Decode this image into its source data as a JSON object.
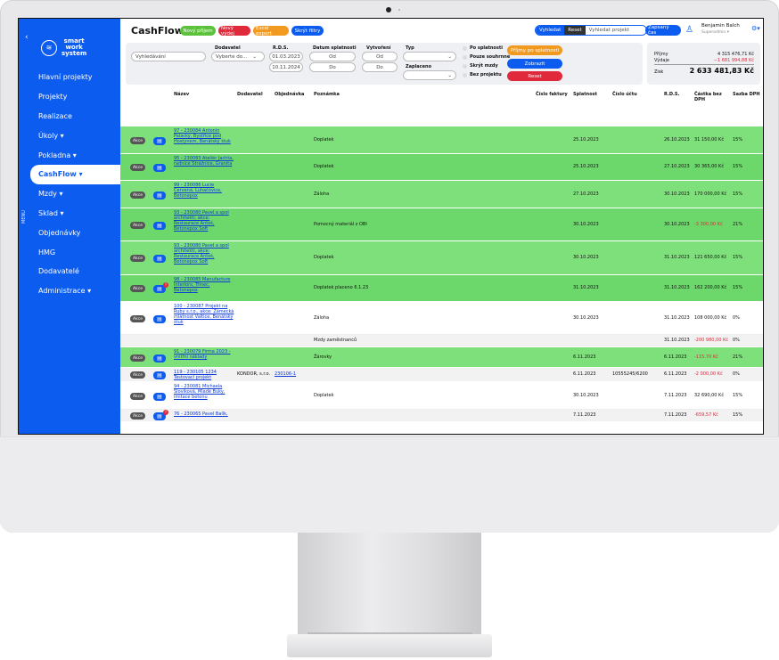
{
  "app": {
    "title": "CashFlow"
  },
  "sidebar": {
    "logo_lines": [
      "smart",
      "work",
      "system"
    ],
    "collapse_glyph": "‹",
    "menu_side": "MENU",
    "items": [
      {
        "label": "Hlavní projekty",
        "active": false
      },
      {
        "label": "Projekty",
        "active": false
      },
      {
        "label": "Realizace",
        "active": false
      },
      {
        "label": "Úkoly ▾",
        "active": false
      },
      {
        "label": "Pokladna ▾",
        "active": false
      },
      {
        "label": "CashFlow ▾",
        "active": true
      },
      {
        "label": "Mzdy ▾",
        "active": false
      },
      {
        "label": "Sklad ▾",
        "active": false
      },
      {
        "label": "Objednávky",
        "active": false
      },
      {
        "label": "HMG",
        "active": false
      },
      {
        "label": "Dodavatelé",
        "active": false
      },
      {
        "label": "Administrace ▾",
        "active": false
      }
    ]
  },
  "toolbar": {
    "novy_prijem": "Nový příjem",
    "novy_vydej": "Nový výdej",
    "excel_export": "Excel export",
    "skryt_filtry": "Skrýt filtry",
    "vyhledat": "Vyhledat",
    "reset": "Reset",
    "project_search_placeholder": "Vyhledat projekt",
    "zapsany_cas": "Zapsaný čas"
  },
  "user": {
    "name": "Benjamin Balch",
    "role": "Superadmin ▾"
  },
  "filters": {
    "search_placeholder": "Vyhledávání",
    "dodavatel_label": "Dodavatel",
    "dodavatel_placeholder": "Vyberte do...",
    "rds_label": "R.D.S.",
    "rds_from": "01.03.2023",
    "rds_to": "10.11.2024",
    "splatnost_label": "Datum splatnosti",
    "od": "Od",
    "do": "Do",
    "vytvoreni_label": "Vytvoření",
    "typ_label": "Typ",
    "zaplaceno_label": "Zaplaceno",
    "checkboxes": [
      "Po splatnosti",
      "Pouze souhrnné",
      "Skrýt mzdy",
      "Bez projektu"
    ],
    "btn_prijmy": "Příjmy po splatnosti",
    "btn_zobrazit": "Zobrazit",
    "btn_reset": "Reset"
  },
  "summary": {
    "prijmy_label": "Příjmy",
    "prijmy_value": "4 315 476,71 Kč",
    "vydaje_label": "Výdaje",
    "vydaje_value": "−1 681 994,88 Kč",
    "zisk_label": "Zisk",
    "zisk_value": "2 633 481,83 Kč"
  },
  "table": {
    "headers": {
      "nazev": "Název",
      "dodavatel": "Dodavatel",
      "objednavka": "Objednávka",
      "poznamka": "Poznámka",
      "cislo_faktury": "Číslo faktury",
      "splatnost": "Splatnost",
      "cislo_uctu": "Číslo účtu",
      "rds": "R.D.S.",
      "castka": "Částka bez DPH",
      "sazba": "Sazba DPH"
    },
    "akce_label": "Akce",
    "rows": [
      {
        "style": "green",
        "akce": true,
        "alert": false,
        "name": "97 - 230084 Antonín Palacký, Bystřice pod Hostýnem, Benátský štuk",
        "dodavatel": "",
        "objednavka": "",
        "poznamka": "Doplatek",
        "splatnost": "25.10.2023",
        "cislo_uctu": "",
        "rds": "26.10.2023",
        "castka": "31 150,00 Kč",
        "sazba": "15%",
        "negative": false
      },
      {
        "style": "greendark",
        "akce": true,
        "alert": false,
        "name": "95 - 230083 Ateliér Jachta, radnice Strážnice, Granita",
        "dodavatel": "",
        "objednavka": "",
        "poznamka": "Doplatek",
        "splatnost": "25.10.2023",
        "cislo_uctu": "",
        "rds": "27.10.2023",
        "castka": "30 365,00 Kč",
        "sazba": "15%",
        "negative": false
      },
      {
        "style": "green",
        "akce": true,
        "alert": false,
        "name": "99 - 230086 Lucie Červená, Luhačovice, Betonepox",
        "dodavatel": "",
        "objednavka": "",
        "poznamka": "Záloha",
        "splatnost": "27.10.2023",
        "cislo_uctu": "",
        "rds": "30.10.2023",
        "castka": "170 000,00 Kč",
        "sazba": "15%",
        "negative": false
      },
      {
        "style": "greendark",
        "akce": true,
        "alert": false,
        "name": "93 - 230080 Pavel a spol architekti, akce: Restaurace Antoš, Betonepox Soft",
        "dodavatel": "",
        "objednavka": "",
        "poznamka": "Pomocný materiál z OBI",
        "splatnost": "30.10.2023",
        "cislo_uctu": "",
        "rds": "30.10.2023",
        "castka": "-3 300,00 Kč",
        "sazba": "21%",
        "negative": true
      },
      {
        "style": "green",
        "akce": true,
        "alert": false,
        "name": "93 - 230080 Pavel a spol architekti, akce: Restaurace Antoš, Betonepox Soft",
        "dodavatel": "",
        "objednavka": "",
        "poznamka": "Doplatek",
        "splatnost": "30.10.2023",
        "cislo_uctu": "",
        "rds": "31.10.2023",
        "castka": "121 650,00 Kč",
        "sazba": "15%",
        "negative": false
      },
      {
        "style": "greendark",
        "akce": true,
        "alert": true,
        "name": "98 - 230085 Manufacture Interiors, Třinec, Betonepox",
        "dodavatel": "",
        "objednavka": "",
        "poznamka": "Doplatek placeno 6.1.23",
        "splatnost": "31.10.2023",
        "cislo_uctu": "",
        "rds": "31.10.2023",
        "castka": "162 200,00 Kč",
        "sazba": "15%",
        "negative": false
      },
      {
        "style": "white",
        "akce": true,
        "alert": false,
        "name": "100 - 230087 Projekt na Ruby s.r.o., akce: Zámecká mlátnost Valtice, Benátský štuk",
        "dodavatel": "",
        "objednavka": "",
        "poznamka": "Záloha",
        "splatnost": "30.10.2023",
        "cislo_uctu": "",
        "rds": "31.10.2023",
        "castka": "108 000,00 Kč",
        "sazba": "0%",
        "negative": false
      },
      {
        "style": "gray",
        "akce": false,
        "alert": false,
        "name": "",
        "dodavatel": "",
        "objednavka": "",
        "poznamka": "Mzdy zaměstnanců",
        "splatnost": "",
        "cislo_uctu": "",
        "rds": "31.10.2023",
        "castka": "-200 980,00 Kč",
        "sazba": "0%",
        "negative": true
      },
      {
        "style": "green",
        "akce": true,
        "alert": false,
        "name": "91 - 230079 Firma 2023 - vnitřní náklady",
        "dodavatel": "",
        "objednavka": "",
        "poznamka": "Žárovky",
        "splatnost": "6.11.2023",
        "cislo_uctu": "",
        "rds": "6.11.2023",
        "castka": "-115,70 Kč",
        "sazba": "21%",
        "negative": true
      },
      {
        "style": "gray",
        "akce": true,
        "alert": false,
        "name": "119 - 230105 1234 Testovací projekt",
        "dodavatel": "KONDOR, s.r.o.",
        "objednavka": "230106-1",
        "poznamka": "",
        "splatnost": "6.11.2023",
        "cislo_uctu": "10555245/6200",
        "rds": "6.11.2023",
        "castka": "-2 000,00 Kč",
        "sazba": "0%",
        "negative": true
      },
      {
        "style": "white",
        "akce": true,
        "alert": false,
        "name": "94 - 230081 Michaela Slovíková, Mladé Buky, imitace betonu",
        "dodavatel": "",
        "objednavka": "",
        "poznamka": "Doplatek",
        "splatnost": "30.10.2023",
        "cislo_uctu": "",
        "rds": "7.11.2023",
        "castka": "32 690,00 Kč",
        "sazba": "15%",
        "negative": false
      },
      {
        "style": "gray",
        "akce": true,
        "alert": true,
        "name": "76 - 230065 Pavel Balík,",
        "dodavatel": "",
        "objednavka": "",
        "poznamka": "",
        "splatnost": "7.11.2023",
        "cislo_uctu": "",
        "rds": "7.11.2023",
        "castka": "-659,57 Kč",
        "sazba": "15%",
        "negative": true
      }
    ]
  },
  "colors": {
    "primary": "#0d5cf0",
    "green": "#7ee07a",
    "danger": "#e0293a",
    "orange": "#f29a1f",
    "success": "#5cc23c"
  }
}
